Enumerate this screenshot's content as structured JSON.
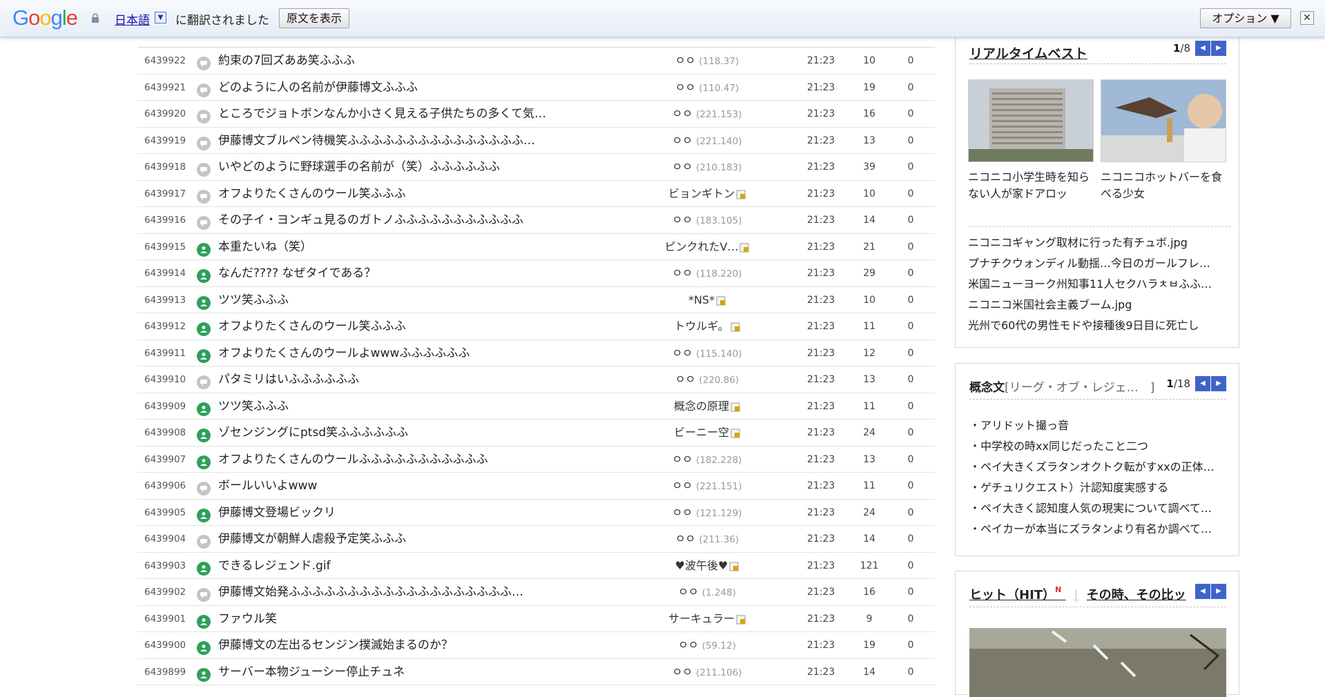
{
  "translate_bar": {
    "logo": "Google",
    "language": "日本語",
    "dropdown_glyph": "▼",
    "translated_text": "に翻訳されました",
    "show_original": "原文を表示",
    "options": "オプション ▼",
    "close_glyph": "✕"
  },
  "rows": [
    {
      "num": "6439922",
      "icon": "talk",
      "title": "約束の7回ズああ笑ふふふ",
      "author": "ㅇㅇ",
      "ip": "(118.37)",
      "badge": false,
      "time": "21:23",
      "views": "10",
      "rec": "0"
    },
    {
      "num": "6439921",
      "icon": "talk",
      "title": "どのように人の名前が伊藤博文ふふふ",
      "author": "ㅇㅇ",
      "ip": "(110.47)",
      "badge": false,
      "time": "21:23",
      "views": "19",
      "rec": "0"
    },
    {
      "num": "6439920",
      "icon": "talk",
      "title": "ところでジョトボンなんか小さく見える子供たちの多くて気…",
      "author": "ㅇㅇ",
      "ip": "(221.153)",
      "badge": false,
      "time": "21:23",
      "views": "16",
      "rec": "0"
    },
    {
      "num": "6439919",
      "icon": "talk",
      "title": "伊藤博文ブルペン待機笑ふふふふふふふふふふふふふふふ…",
      "author": "ㅇㅇ",
      "ip": "(221.140)",
      "badge": false,
      "time": "21:23",
      "views": "13",
      "rec": "0"
    },
    {
      "num": "6439918",
      "icon": "talk",
      "title": "いやどのように野球選手の名前が（笑）ふふふふふふ",
      "author": "ㅇㅇ",
      "ip": "(210.183)",
      "badge": false,
      "time": "21:23",
      "views": "39",
      "rec": "0"
    },
    {
      "num": "6439917",
      "icon": "talk",
      "title": "オフよりたくさんのウール笑ふふふ",
      "author": "ビョンギトン",
      "ip": "",
      "badge": true,
      "time": "21:23",
      "views": "10",
      "rec": "0"
    },
    {
      "num": "6439916",
      "icon": "talk",
      "title": "その子イ・ヨンギュ見るのガトノふふふふふふふふふふふ",
      "author": "ㅇㅇ",
      "ip": "(183.105)",
      "badge": false,
      "time": "21:23",
      "views": "14",
      "rec": "0"
    },
    {
      "num": "6439915",
      "icon": "image",
      "title": "本重たいね（笑）",
      "author": "ピンクれたV…",
      "ip": "",
      "badge": true,
      "time": "21:23",
      "views": "21",
      "rec": "0"
    },
    {
      "num": "6439914",
      "icon": "image",
      "title": "なんだ???? なぜタイである？",
      "author": "ㅇㅇ",
      "ip": "(118.220)",
      "badge": false,
      "time": "21:23",
      "views": "29",
      "rec": "0"
    },
    {
      "num": "6439913",
      "icon": "image",
      "title": "ツツ笑ふふふ",
      "author": "*NS*",
      "ip": "",
      "badge": true,
      "time": "21:23",
      "views": "10",
      "rec": "0"
    },
    {
      "num": "6439912",
      "icon": "image",
      "title": "オフよりたくさんのウール笑ふふふ",
      "author": "トウルギ。",
      "ip": "",
      "badge": true,
      "time": "21:23",
      "views": "11",
      "rec": "0"
    },
    {
      "num": "6439911",
      "icon": "image",
      "title": "オフよりたくさんのウールよwwwふふふふふふ",
      "author": "ㅇㅇ",
      "ip": "(115.140)",
      "badge": false,
      "time": "21:23",
      "views": "12",
      "rec": "0"
    },
    {
      "num": "6439910",
      "icon": "talk",
      "title": "パタミリはいふふふふふふ",
      "author": "ㅇㅇ",
      "ip": "(220.86)",
      "badge": false,
      "time": "21:23",
      "views": "13",
      "rec": "0"
    },
    {
      "num": "6439909",
      "icon": "image",
      "title": "ツツ笑ふふふ",
      "author": "概念の原理",
      "ip": "",
      "badge": true,
      "time": "21:23",
      "views": "11",
      "rec": "0"
    },
    {
      "num": "6439908",
      "icon": "image",
      "title": "ゾセンジングにptsd笑ふふふふふふ",
      "author": "ビーニー空",
      "ip": "",
      "badge": true,
      "time": "21:23",
      "views": "24",
      "rec": "0"
    },
    {
      "num": "6439907",
      "icon": "image",
      "title": "オフよりたくさんのウールふふふふふふふふふふふ",
      "author": "ㅇㅇ",
      "ip": "(182.228)",
      "badge": false,
      "time": "21:23",
      "views": "13",
      "rec": "0"
    },
    {
      "num": "6439906",
      "icon": "talk",
      "title": "ボールいいよwww",
      "author": "ㅇㅇ",
      "ip": "(221.151)",
      "badge": false,
      "time": "21:23",
      "views": "11",
      "rec": "0"
    },
    {
      "num": "6439905",
      "icon": "image",
      "title": "伊藤博文登場ビックリ",
      "author": "ㅇㅇ",
      "ip": "(121.129)",
      "badge": false,
      "time": "21:23",
      "views": "24",
      "rec": "0"
    },
    {
      "num": "6439904",
      "icon": "talk",
      "title": "伊藤博文が朝鮮人虐殺予定笑ふふふ",
      "author": "ㅇㅇ",
      "ip": "(211.36)",
      "badge": false,
      "time": "21:23",
      "views": "14",
      "rec": "0"
    },
    {
      "num": "6439903",
      "icon": "image",
      "title": "できるレジェンド.gif",
      "author": "♥波午後♥",
      "ip": "",
      "badge": true,
      "time": "21:23",
      "views": "121",
      "rec": "0"
    },
    {
      "num": "6439902",
      "icon": "talk",
      "title": "伊藤博文始発ふふふふふふふふふふふふふふふふふふふ…",
      "author": "ㅇㅇ",
      "ip": "(1.248)",
      "badge": false,
      "time": "21:23",
      "views": "16",
      "rec": "0"
    },
    {
      "num": "6439901",
      "icon": "image",
      "title": "ファウル笑",
      "author": "サーキュラー",
      "ip": "",
      "badge": true,
      "time": "21:23",
      "views": "9",
      "rec": "0"
    },
    {
      "num": "6439900",
      "icon": "image",
      "title": "伊藤博文の左出るセンジン撲滅始まるのか？",
      "author": "ㅇㅇ",
      "ip": "(59.12)",
      "badge": false,
      "time": "21:23",
      "views": "19",
      "rec": "0"
    },
    {
      "num": "6439899",
      "icon": "image",
      "title": "サーバー本物ジューシー停止チュネ",
      "author": "ㅇㅇ",
      "ip": "(211.106)",
      "badge": false,
      "time": "21:23",
      "views": "14",
      "rec": "0"
    }
  ],
  "sidebar": {
    "realtime": {
      "title": "リアルタイムベスト",
      "page_current": "1",
      "page_total": "/8",
      "prev_glyph": "◀",
      "next_glyph": "▶",
      "thumbs": [
        {
          "caption": "ニコニコ小学生時を知らない人が家ドアロッ"
        },
        {
          "caption": "ニコニコホットバーを食べる少女"
        }
      ],
      "list": [
        "ニコニコギャング取材に行った有チュボ.jpg",
        "プナチクウォンディル動揺…今日のガールフレ…",
        "米国ニューヨーク州知事11人セクハラㅊㅂふふ…",
        "ニコニコ米国社会主義ブーム.jpg",
        "光州で60代の男性モドや接種後9日目に死亡し"
      ]
    },
    "concept": {
      "title": "概念文",
      "subtitle": "[リーグ・オブ・レジェ…　]",
      "page_current": "1",
      "page_total": "/18",
      "prev_glyph": "◀",
      "next_glyph": "▶",
      "list": [
        "・アリドット撮っ音",
        "・中学校の時xx同じだったこと二つ",
        "・ペイ大きくズラタンオクトク転がすxxの正体…",
        "・ゲチュリクエスト）汁認知度実感する",
        "・ペイ大きく認知度人気の現実について調べて…",
        "・ペイカーが本当にズラタンより有名か調べて…"
      ]
    },
    "hit": {
      "title": "ヒット（HIT）",
      "new_mark": "N",
      "divider": "|",
      "second_title": "その時、その比ッ",
      "prev_glyph": "◀",
      "next_glyph": "▶"
    }
  },
  "colors": {
    "accent": "#3f63c9",
    "image_icon": "#2ea05a",
    "talk_icon": "#c4c4c4",
    "badge": "#d9a400"
  }
}
